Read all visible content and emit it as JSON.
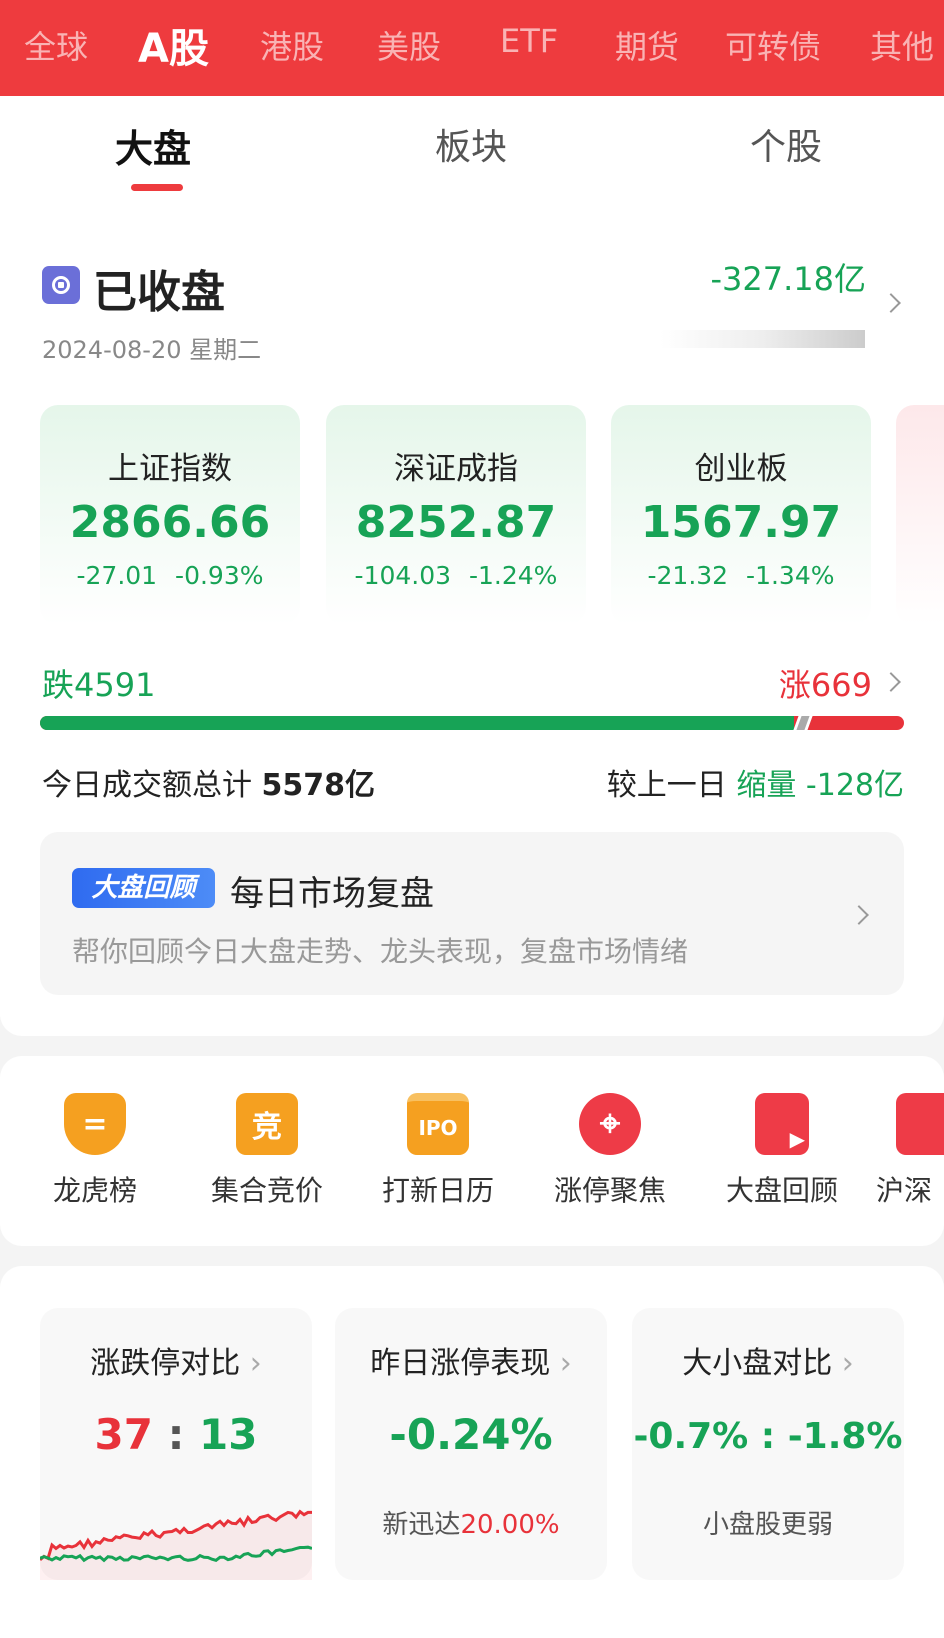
{
  "market_tabs": [
    "全球",
    "A股",
    "港股",
    "美股",
    "ETF",
    "期货",
    "可转债",
    "其他"
  ],
  "sub_tabs": [
    "大盘",
    "板块",
    "个股"
  ],
  "status": {
    "label": "已收盘",
    "date": "2024-08-20 星期二",
    "net_flow": "-327.18亿"
  },
  "indices": [
    {
      "name": "上证指数",
      "value": "2866.66",
      "change": "-27.01",
      "pct": "-0.93%"
    },
    {
      "name": "深证成指",
      "value": "8252.87",
      "change": "-104.03",
      "pct": "-1.24%"
    },
    {
      "name": "创业板",
      "value": "1567.97",
      "change": "-21.32",
      "pct": "-1.34%"
    }
  ],
  "breadth": {
    "down_label": "跌",
    "down": "4591",
    "up_label": "涨",
    "up": "669",
    "down_fraction": 0.873
  },
  "volume": {
    "label": "今日成交额总计",
    "total": "5578亿",
    "compare_label": "较上一日",
    "trend": "缩量",
    "delta": "-128亿"
  },
  "review": {
    "badge": "大盘回顾",
    "title": "每日市场复盘",
    "subtitle": "帮你回顾今日大盘走势、龙头表现，复盘市场情绪"
  },
  "tools": [
    {
      "label": "龙虎榜",
      "icon": "shield-icon",
      "glyph": "="
    },
    {
      "label": "集合竞价",
      "icon": "auction-icon",
      "glyph": "竞"
    },
    {
      "label": "打新日历",
      "icon": "ipo-calendar-icon",
      "glyph": "IPO"
    },
    {
      "label": "涨停聚焦",
      "icon": "target-icon",
      "glyph": "⌖"
    },
    {
      "label": "大盘回顾",
      "icon": "review-play-icon",
      "glyph": "▶"
    },
    {
      "label": "沪深",
      "icon": "hs-icon",
      "glyph": ""
    }
  ],
  "colors": {
    "red": "#ee3b3e",
    "green": "#17a356",
    "orange": "#f5a020"
  },
  "bottom": {
    "limit": {
      "title": "涨跌停对比",
      "up": "37",
      "sep": ":",
      "down": "13"
    },
    "yesterday": {
      "title": "昨日涨停表现",
      "value": "-0.24%",
      "stock": "新迅达",
      "stock_pct": "20.00%"
    },
    "size": {
      "title": "大小盘对比",
      "value": "-0.7% : -1.8%",
      "note": "小盘股更弱"
    }
  }
}
